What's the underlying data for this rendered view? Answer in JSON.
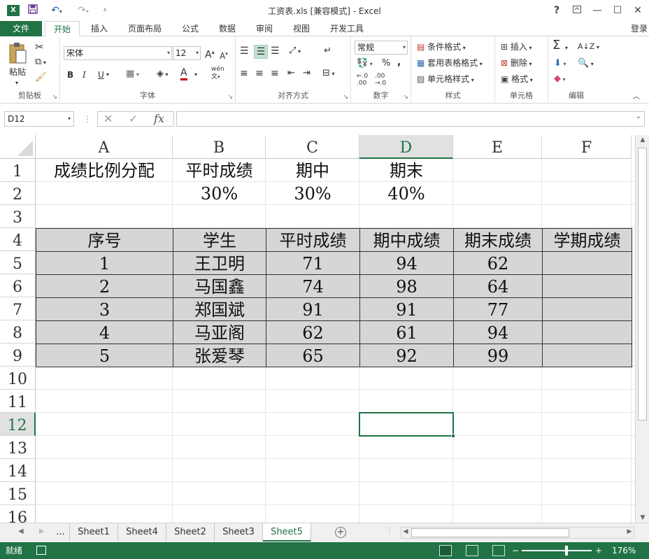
{
  "app": {
    "logo": "X",
    "title": "工资表.xls  [兼容模式] - Excel",
    "help": "?",
    "login": "登录"
  },
  "ribbon_tabs": [
    "文件",
    "开始",
    "插入",
    "页面布局",
    "公式",
    "数据",
    "审阅",
    "视图",
    "开发工具"
  ],
  "ribbon": {
    "clipboard": {
      "label": "剪贴板",
      "paste": "粘贴"
    },
    "font": {
      "label": "字体",
      "name": "宋体",
      "size": "12",
      "bold": "B",
      "italic": "I",
      "underline": "U",
      "wen": "wén",
      "grow": "A",
      "shrink": "A",
      "color": "A"
    },
    "alignment": {
      "label": "对齐方式"
    },
    "number": {
      "label": "数字",
      "format": "常规",
      "percent": "%",
      "comma": ","
    },
    "styles": {
      "label": "样式",
      "cond": "条件格式",
      "table": "套用表格格式",
      "cell": "单元格样式"
    },
    "cells": {
      "label": "单元格",
      "insert": "插入",
      "delete": "删除",
      "format": "格式"
    },
    "editing": {
      "label": "编辑",
      "sum": "Σ"
    }
  },
  "formula_bar": {
    "name_box": "D12",
    "fx": "fx",
    "formula": ""
  },
  "columns": [
    "A",
    "B",
    "C",
    "D",
    "E",
    "F"
  ],
  "rows": [
    "1",
    "2",
    "3",
    "4",
    "5",
    "6",
    "7",
    "8",
    "9",
    "10",
    "11",
    "12",
    "13",
    "14",
    "15",
    "16"
  ],
  "cells": {
    "A1": "成绩比例分配",
    "B1": "平时成绩",
    "C1": "期中",
    "D1": "期末",
    "B2": "30%",
    "C2": "30%",
    "D2": "40%",
    "A4": "序号",
    "B4": "学生",
    "C4": "平时成绩",
    "D4": "期中成绩",
    "E4": "期末成绩",
    "F4": "学期成绩",
    "A5": "1",
    "B5": "王卫明",
    "C5": "71",
    "D5": "94",
    "E5": "62",
    "A6": "2",
    "B6": "马国鑫",
    "C6": "74",
    "D6": "98",
    "E6": "64",
    "A7": "3",
    "B7": "郑国斌",
    "C7": "91",
    "D7": "91",
    "E7": "77",
    "A8": "4",
    "B8": "马亚阁",
    "C8": "62",
    "D8": "61",
    "E8": "94",
    "A9": "5",
    "B9": "张爱琴",
    "C9": "65",
    "D9": "92",
    "E9": "99"
  },
  "selected_cell": "D12",
  "sheets": {
    "more": "...",
    "tabs": [
      "Sheet1",
      "Sheet4",
      "Sheet2",
      "Sheet3",
      "Sheet5"
    ],
    "active": "Sheet5"
  },
  "status": {
    "mode": "就绪",
    "zoom": "176%"
  },
  "colors": {
    "accent": "#217346",
    "table_fill": "#d6d6d6"
  }
}
